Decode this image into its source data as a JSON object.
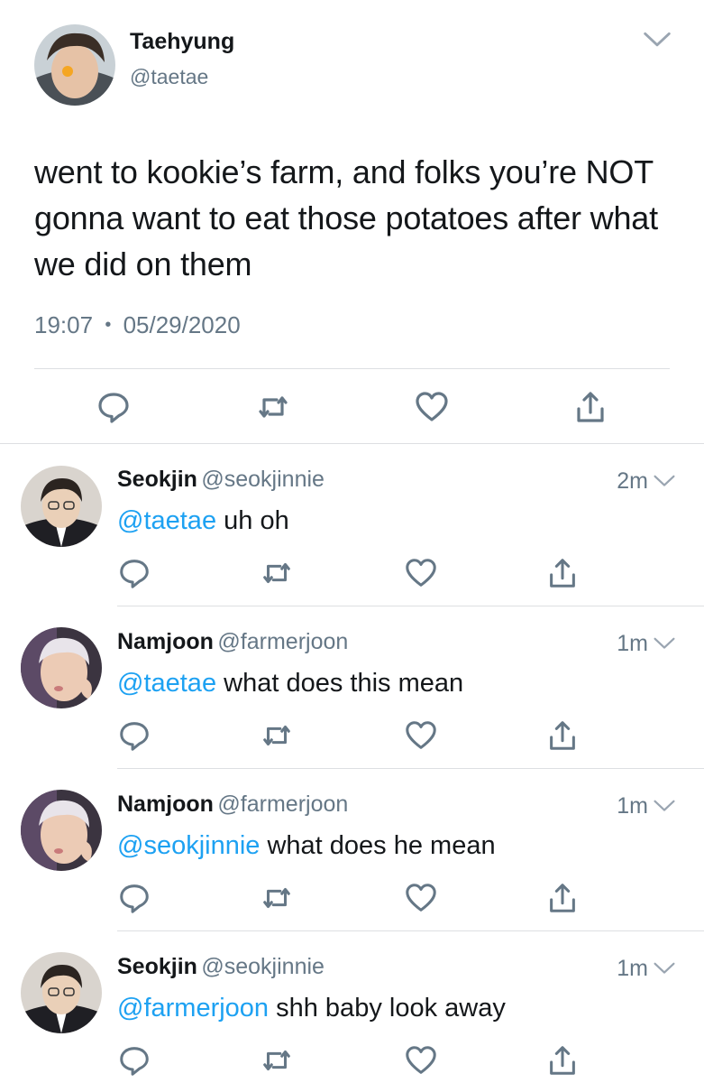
{
  "main_tweet": {
    "display_name": "Taehyung",
    "handle": "@taetae",
    "text": "went to kookie’s farm, and folks you’re NOT gonna want to eat those potatoes after what we did on them",
    "time": "19:07",
    "separator": "•",
    "date": "05/29/2020"
  },
  "replies": [
    {
      "display_name": "Seokjin",
      "handle": "@seokjinnie",
      "time": "2m",
      "mention": "@taetae",
      "text": " uh oh"
    },
    {
      "display_name": "Namjoon",
      "handle": "@farmerjoon",
      "time": "1m",
      "mention": "@taetae",
      "text": " what does this mean"
    },
    {
      "display_name": "Namjoon",
      "handle": "@farmerjoon",
      "time": "1m",
      "mention": "@seokjinnie",
      "text": " what does he mean"
    },
    {
      "display_name": "Seokjin",
      "handle": "@seokjinnie",
      "time": "1m",
      "mention": "@farmerjoon",
      "text": " shh baby look away"
    }
  ],
  "icons": {
    "reply": "reply-icon",
    "retweet": "retweet-icon",
    "like": "heart-icon",
    "share": "share-icon",
    "more": "chevron-down-icon"
  },
  "colors": {
    "mention": "#1da1f2",
    "secondary_text": "#657786",
    "icon": "#657786",
    "divider": "#dddfe2"
  }
}
